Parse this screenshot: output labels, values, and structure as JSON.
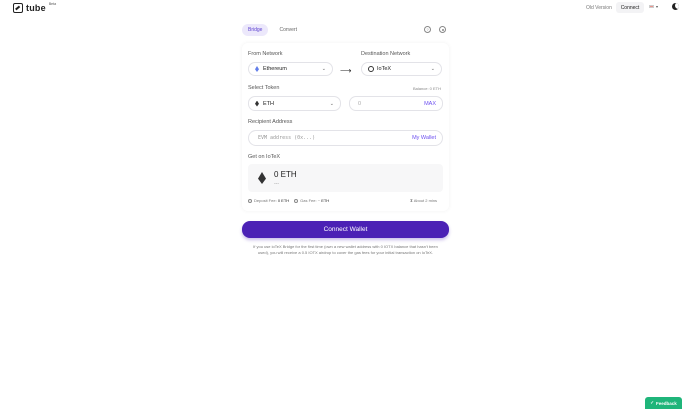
{
  "header": {
    "logo_text": "tube",
    "logo_badge": "Beta",
    "old_version": "Old Version",
    "connect": "Connect",
    "language": "▾"
  },
  "tabs": [
    {
      "label": "Bridge",
      "active": true
    },
    {
      "label": "Convert",
      "active": false
    }
  ],
  "icons": {
    "help": "?",
    "settings": "gear-icon",
    "theme": "moon-icon"
  },
  "form": {
    "from_label": "From Network",
    "from_value": "Ethereum",
    "dest_label": "Destination Network",
    "dest_value": "IoTeX",
    "arrow": "⟶",
    "token_label": "Select Token",
    "token_value": "ETH",
    "balance": "Balance: 0 ETH",
    "amount_placeholder": "0",
    "max": "MAX",
    "recipient_label": "Recipient Address",
    "recipient_placeholder": "EVM address (0x...)",
    "my_wallet": "My Wallet",
    "get_label": "Get on IoTeX",
    "get_amount": "0 ETH",
    "get_sub": "---",
    "deposit_fee_label": "Deposit Fee:",
    "deposit_fee_value": "0 ETH",
    "gas_fee_label": "Gas Fee: ~",
    "gas_fee_value": "ETH",
    "time": "About 2 mins"
  },
  "connect_wallet": "Connect Wallet",
  "note": "If you use ioTeX Bridge for the first time (own a new wallet address with 0 IOTX balance that hasn't been used), you will receive a 0.5 IOTX airdrop to cover the gas fees for your initial transaction on IoTeX.",
  "feedback": "Feedback",
  "colors": {
    "accent": "#6d4ff0",
    "button": "#4b21b5",
    "feedback": "#1fb57a"
  }
}
